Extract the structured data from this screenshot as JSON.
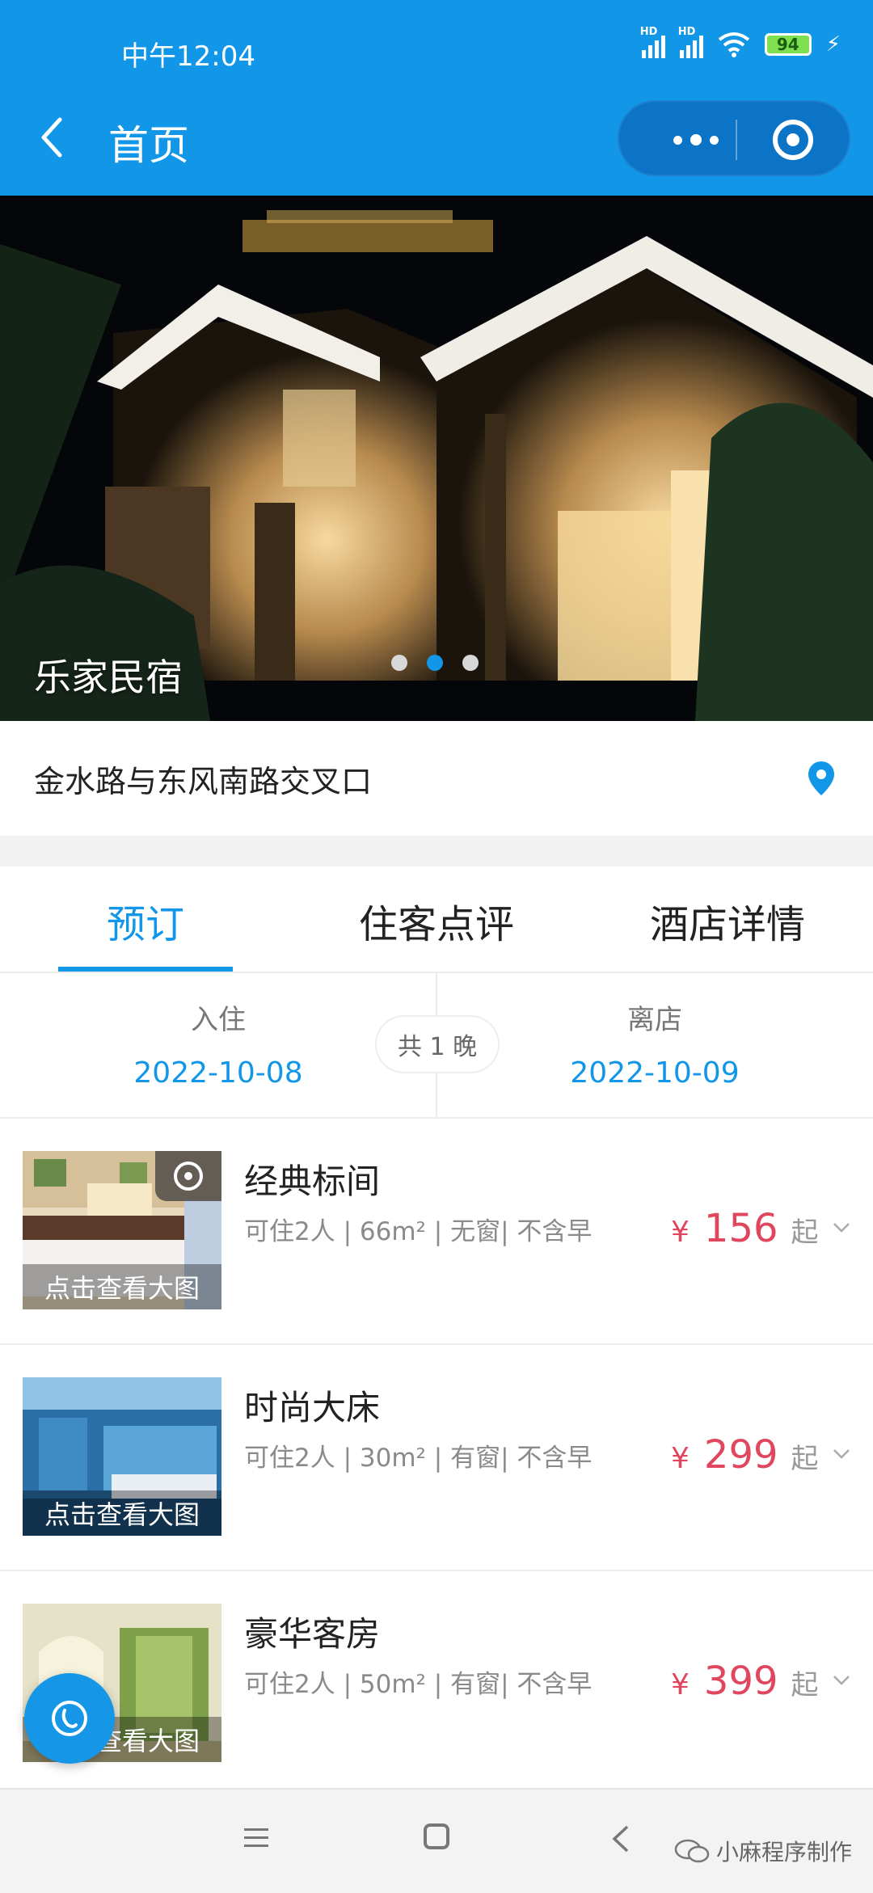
{
  "status_bar": {
    "time": "中午12:04",
    "battery": "94",
    "sim1": "HD",
    "sim2": "HD"
  },
  "nav": {
    "title": "首页"
  },
  "hero": {
    "hotel_name": "乐家民宿",
    "page_count": 3,
    "active_page": 2
  },
  "address": {
    "text": "金水路与东风南路交叉口"
  },
  "tabs": [
    {
      "label": "预订",
      "active": true
    },
    {
      "label": "住客点评",
      "active": false
    },
    {
      "label": "酒店详情",
      "active": false
    }
  ],
  "stay": {
    "checkin_label": "入住",
    "checkin_date": "2022-10-08",
    "nights": "共 1 晚",
    "checkout_label": "离店",
    "checkout_date": "2022-10-09"
  },
  "rooms": [
    {
      "name": "经典标间",
      "desc": "可住2人 | 66m² | 无窗| 不含早",
      "currency": "¥",
      "price": "156",
      "suffix": "起",
      "caption": "点击查看大图",
      "thumb_theme": "warm"
    },
    {
      "name": "时尚大床",
      "desc": "可住2人 | 30m² | 有窗| 不含早",
      "currency": "¥",
      "price": "299",
      "suffix": "起",
      "caption": "点击查看大图",
      "thumb_theme": "blue"
    },
    {
      "name": "豪华客房",
      "desc": "可住2人 | 50m² | 有窗| 不含早",
      "currency": "¥",
      "price": "399",
      "suffix": "起",
      "caption": "点击查看大图",
      "thumb_theme": "green"
    }
  ],
  "watermark": "小麻程序制作",
  "colors": {
    "primary": "#1296e8",
    "price": "#e0465e"
  }
}
